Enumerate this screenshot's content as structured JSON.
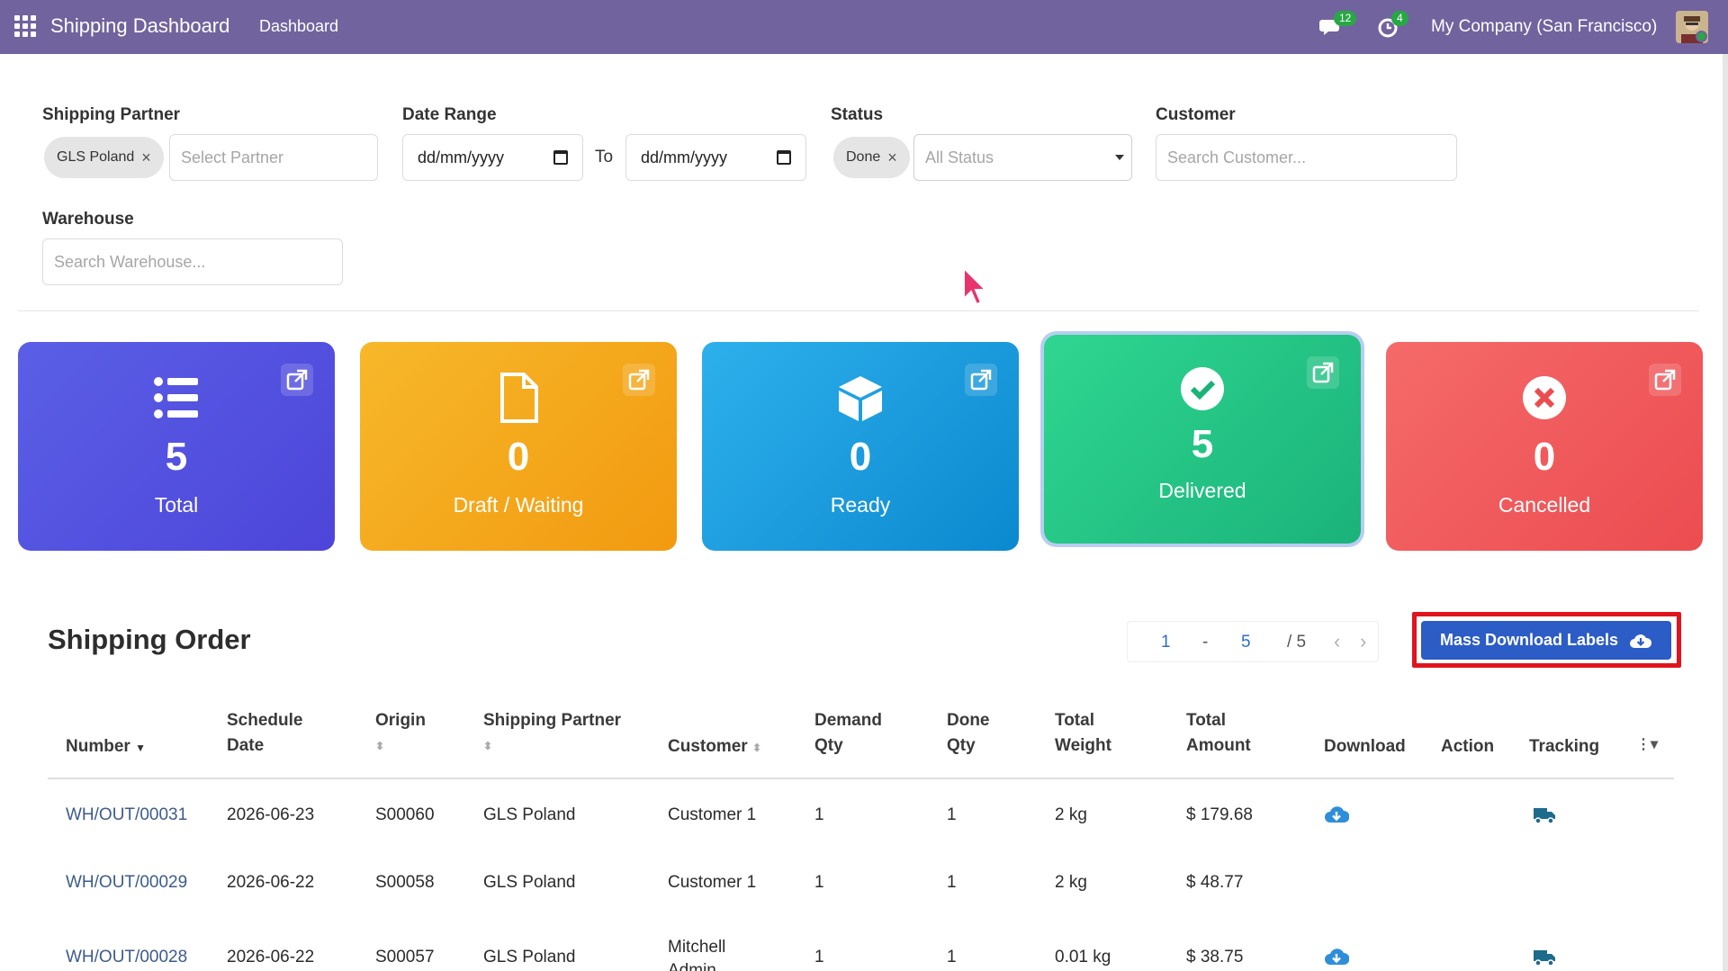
{
  "navbar": {
    "app_title": "Shipping Dashboard",
    "menu_item": "Dashboard",
    "messages_count": "12",
    "activities_count": "4",
    "company": "My Company (San Francisco)"
  },
  "filters": {
    "shipping_partner": {
      "label": "Shipping Partner",
      "chip": "GLS Poland",
      "placeholder": "Select Partner"
    },
    "date_range": {
      "label": "Date Range",
      "from": "dd/mm/yyyy",
      "to_label": "To",
      "to": "dd/mm/yyyy"
    },
    "status": {
      "label": "Status",
      "chip": "Done",
      "placeholder": "All Status"
    },
    "customer": {
      "label": "Customer",
      "placeholder": "Search Customer..."
    },
    "warehouse": {
      "label": "Warehouse",
      "placeholder": "Search Warehouse..."
    }
  },
  "cards": [
    {
      "value": "5",
      "label": "Total",
      "icon": "list-icon",
      "color": "#5553e0"
    },
    {
      "value": "0",
      "label": "Draft / Waiting",
      "icon": "file-icon",
      "color": "#f5ab1b"
    },
    {
      "value": "0",
      "label": "Ready",
      "icon": "box-icon",
      "color": "#1a9cdd"
    },
    {
      "value": "5",
      "label": "Delivered",
      "icon": "check-circle-icon",
      "color": "#23c585"
    },
    {
      "value": "0",
      "label": "Cancelled",
      "icon": "x-circle-icon",
      "color": "#f05c5e"
    }
  ],
  "section": {
    "title": "Shipping Order",
    "pager": {
      "start": "1",
      "sep": "-",
      "end": "5",
      "total": "/ 5"
    },
    "mass_download": "Mass Download Labels"
  },
  "table": {
    "headers": {
      "number": "Number",
      "schedule_date_1": "Schedule",
      "schedule_date_2": "Date",
      "origin": "Origin",
      "shipping_partner": "Shipping Partner",
      "customer": "Customer",
      "demand_qty_1": "Demand",
      "demand_qty_2": "Qty",
      "done_qty_1": "Done",
      "done_qty_2": "Qty",
      "total_weight_1": "Total",
      "total_weight_2": "Weight",
      "total_amount_1": "Total",
      "total_amount_2": "Amount",
      "download": "Download",
      "action": "Action",
      "tracking": "Tracking"
    },
    "rows": [
      {
        "number": "WH/OUT/00031",
        "date": "2026-06-23",
        "origin": "S00060",
        "partner": "GLS Poland",
        "customer": "Customer 1",
        "demand": "1",
        "done": "1",
        "weight": "2 kg",
        "amount": "$ 179.68"
      },
      {
        "number": "WH/OUT/00029",
        "date": "2026-06-22",
        "origin": "S00058",
        "partner": "GLS Poland",
        "customer": "Customer 1",
        "demand": "1",
        "done": "1",
        "weight": "2 kg",
        "amount": "$ 48.77"
      },
      {
        "number": "WH/OUT/00028",
        "date": "2026-06-22",
        "origin": "S00057",
        "partner": "GLS Poland",
        "customer": "Mitchell Admin",
        "customer_line1": "Mitchell",
        "customer_line2": "Admin",
        "demand": "1",
        "done": "1",
        "weight": "0.01 kg",
        "amount": "$ 38.75"
      }
    ]
  },
  "colors": {
    "navbar": "#71639e",
    "link": "#3d5c8a",
    "primary_button": "#2c5cc5",
    "highlight_outline": "#e0141e"
  }
}
